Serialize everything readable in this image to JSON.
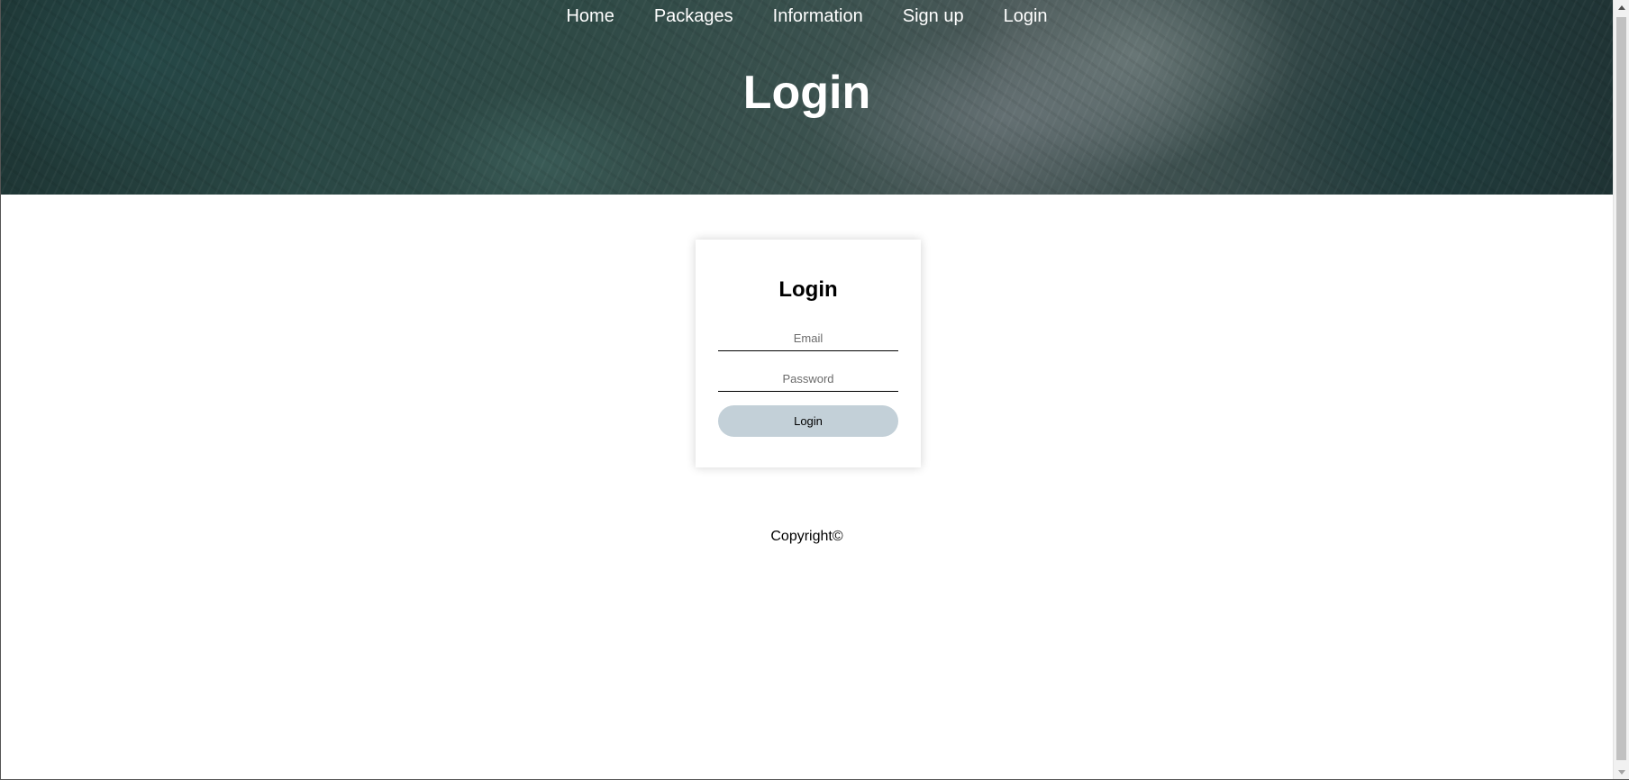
{
  "nav": {
    "items": [
      {
        "label": "Home"
      },
      {
        "label": "Packages"
      },
      {
        "label": "Information"
      },
      {
        "label": "Sign up"
      },
      {
        "label": "Login"
      }
    ]
  },
  "hero": {
    "title": "Login"
  },
  "login_card": {
    "title": "Login",
    "email": {
      "placeholder": "Email",
      "value": ""
    },
    "password": {
      "placeholder": "Password",
      "value": ""
    },
    "submit_label": "Login"
  },
  "footer": {
    "text": "Copyright©"
  },
  "colors": {
    "button_bg": "#c3d0d8",
    "hero_text": "#ffffff"
  },
  "icons": {
    "scroll_up": "scroll-up-arrow-icon",
    "scroll_down": "scroll-down-arrow-icon"
  }
}
